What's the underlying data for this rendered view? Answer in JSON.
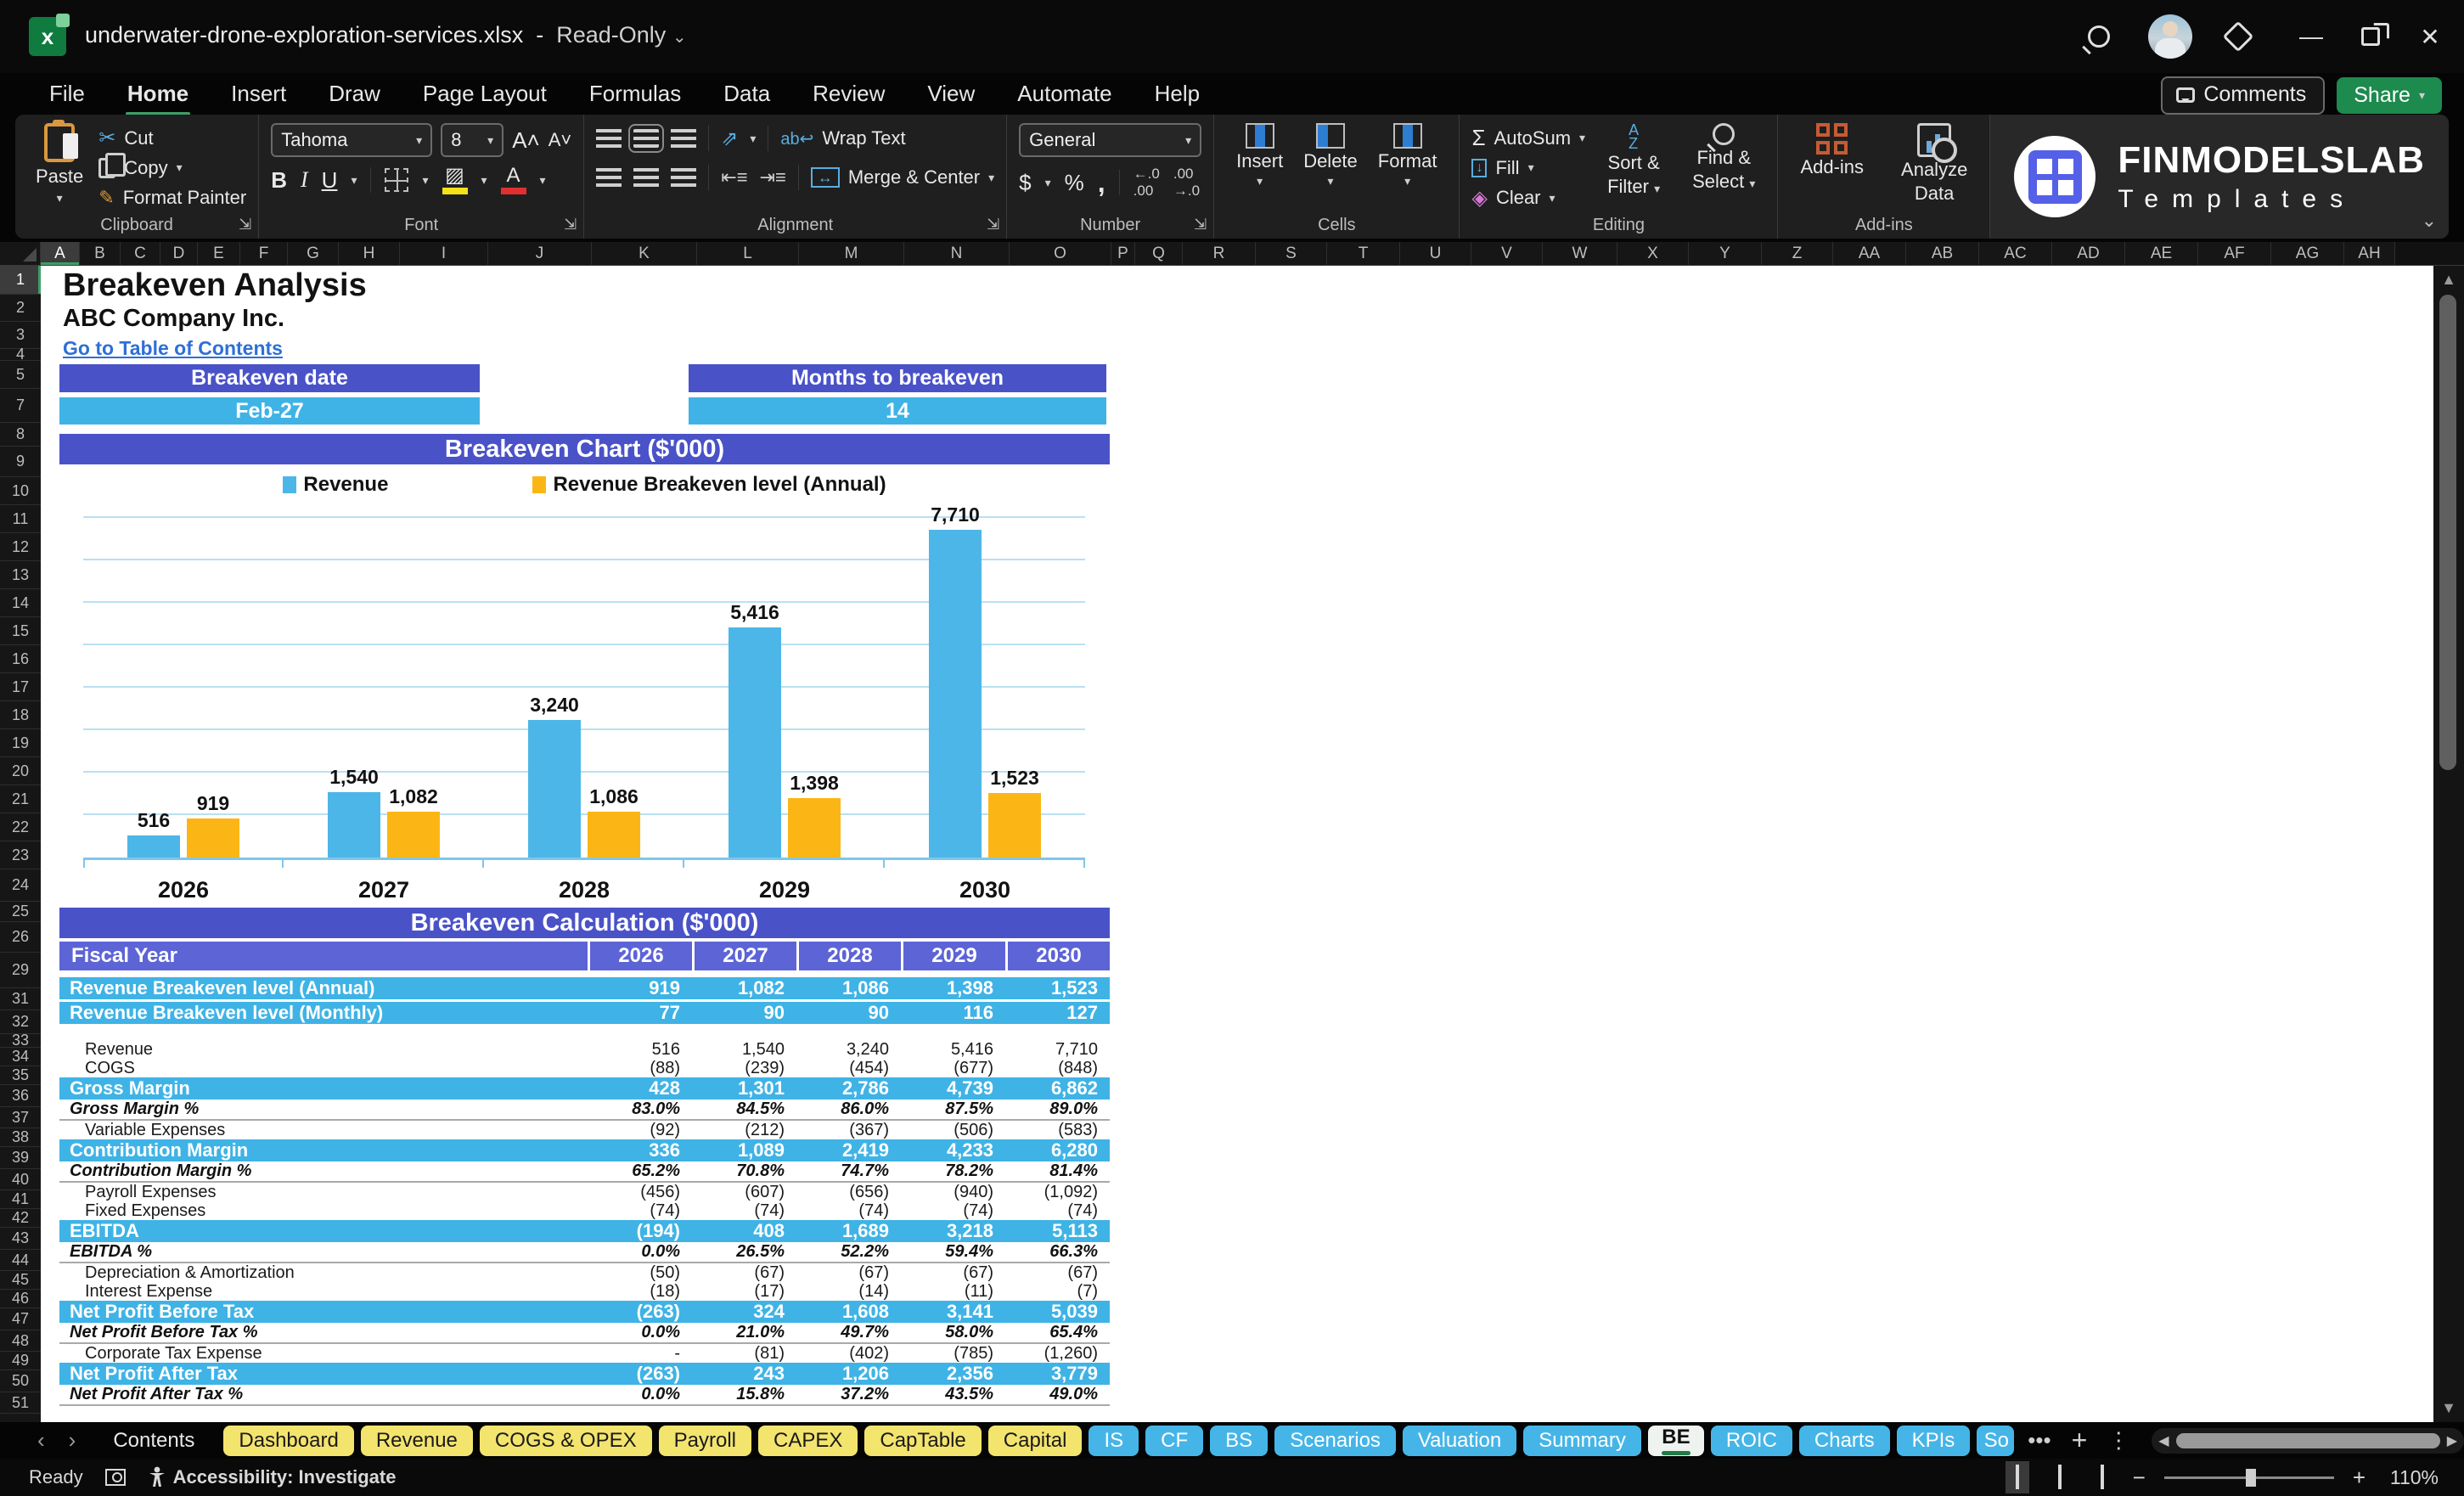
{
  "window": {
    "title": "underwater-drone-exploration-services.xlsx",
    "separator": "-",
    "mode": "Read-Only"
  },
  "menu": {
    "items": [
      "File",
      "Home",
      "Insert",
      "Draw",
      "Page Layout",
      "Formulas",
      "Data",
      "Review",
      "View",
      "Automate",
      "Help"
    ],
    "active": "Home"
  },
  "topright": {
    "comments": "Comments",
    "share": "Share"
  },
  "ribbon": {
    "clipboard": {
      "paste": "Paste",
      "cut": "Cut",
      "copy": "Copy",
      "format_painter": "Format Painter",
      "group": "Clipboard"
    },
    "font": {
      "family": "Tahoma",
      "size": "8",
      "bold": "B",
      "italic": "I",
      "underline": "U",
      "color_letter": "A",
      "group": "Font"
    },
    "alignment": {
      "wrap_text": "Wrap Text",
      "merge_center": "Merge & Center",
      "group": "Alignment"
    },
    "number": {
      "format": "General",
      "currency": "$",
      "percent": "%",
      "comma": ",",
      "group": "Number"
    },
    "cells": {
      "insert": "Insert",
      "delete": "Delete",
      "format": "Format",
      "group": "Cells"
    },
    "editing": {
      "autosum": "AutoSum",
      "fill": "Fill",
      "clear": "Clear",
      "sort_filter1": "Sort &",
      "sort_filter2": "Filter",
      "find_select1": "Find &",
      "find_select2": "Select",
      "sigma": "Σ",
      "group": "Editing"
    },
    "addins": {
      "addins": "Add-ins",
      "analyze1": "Analyze",
      "analyze2": "Data",
      "group": "Add-ins"
    },
    "logo": {
      "brand": "FINMODELSLAB",
      "sub": "Templates"
    }
  },
  "grid": {
    "columns": [
      {
        "label": "A",
        "w": 46
      },
      {
        "label": "B",
        "w": 48
      },
      {
        "label": "C",
        "w": 47
      },
      {
        "label": "D",
        "w": 44
      },
      {
        "label": "E",
        "w": 50
      },
      {
        "label": "F",
        "w": 56
      },
      {
        "label": "G",
        "w": 60
      },
      {
        "label": "H",
        "w": 72
      },
      {
        "label": "I",
        "w": 104
      },
      {
        "label": "J",
        "w": 122
      },
      {
        "label": "K",
        "w": 124
      },
      {
        "label": "L",
        "w": 120
      },
      {
        "label": "M",
        "w": 124
      },
      {
        "label": "N",
        "w": 124
      },
      {
        "label": "O",
        "w": 120
      },
      {
        "label": "P",
        "w": 28
      },
      {
        "label": "Q",
        "w": 56
      },
      {
        "label": "R",
        "w": 86
      },
      {
        "label": "S",
        "w": 84
      },
      {
        "label": "T",
        "w": 86
      },
      {
        "label": "U",
        "w": 84
      },
      {
        "label": "V",
        "w": 84
      },
      {
        "label": "W",
        "w": 88
      },
      {
        "label": "X",
        "w": 84
      },
      {
        "label": "Y",
        "w": 86
      },
      {
        "label": "Z",
        "w": 84
      },
      {
        "label": "AA",
        "w": 86
      },
      {
        "label": "AB",
        "w": 86
      },
      {
        "label": "AC",
        "w": 86
      },
      {
        "label": "AD",
        "w": 86
      },
      {
        "label": "AE",
        "w": 86
      },
      {
        "label": "AF",
        "w": 86
      },
      {
        "label": "AG",
        "w": 86
      },
      {
        "label": "AH",
        "w": 60
      }
    ],
    "rows": [
      {
        "n": "1",
        "h": 34
      },
      {
        "n": "2",
        "h": 32
      },
      {
        "n": "3",
        "h": 32
      },
      {
        "n": "4",
        "h": 14
      },
      {
        "n": "5",
        "h": 33
      },
      {
        "n": "7",
        "h": 40
      },
      {
        "n": "8",
        "h": 28
      },
      {
        "n": "9",
        "h": 36
      },
      {
        "n": "10",
        "h": 33
      },
      {
        "n": "11",
        "h": 33
      },
      {
        "n": "12",
        "h": 33
      },
      {
        "n": "13",
        "h": 33
      },
      {
        "n": "14",
        "h": 33
      },
      {
        "n": "15",
        "h": 33
      },
      {
        "n": "16",
        "h": 33
      },
      {
        "n": "17",
        "h": 33
      },
      {
        "n": "18",
        "h": 33
      },
      {
        "n": "19",
        "h": 33
      },
      {
        "n": "20",
        "h": 33
      },
      {
        "n": "21",
        "h": 33
      },
      {
        "n": "22",
        "h": 33
      },
      {
        "n": "23",
        "h": 33
      },
      {
        "n": "24",
        "h": 38
      },
      {
        "n": "25",
        "h": 24
      },
      {
        "n": "26",
        "h": 36
      },
      {
        "n": "29",
        "h": 42
      },
      {
        "n": "31",
        "h": 26
      },
      {
        "n": "32",
        "h": 28
      },
      {
        "n": "33",
        "h": 16
      },
      {
        "n": "34",
        "h": 22
      },
      {
        "n": "35",
        "h": 22
      },
      {
        "n": "36",
        "h": 26
      },
      {
        "n": "37",
        "h": 25
      },
      {
        "n": "38",
        "h": 22
      },
      {
        "n": "39",
        "h": 26
      },
      {
        "n": "40",
        "h": 25
      },
      {
        "n": "41",
        "h": 22
      },
      {
        "n": "42",
        "h": 22
      },
      {
        "n": "43",
        "h": 26
      },
      {
        "n": "44",
        "h": 25
      },
      {
        "n": "45",
        "h": 22
      },
      {
        "n": "46",
        "h": 22
      },
      {
        "n": "47",
        "h": 26
      },
      {
        "n": "48",
        "h": 25
      },
      {
        "n": "49",
        "h": 22
      },
      {
        "n": "50",
        "h": 26
      },
      {
        "n": "51",
        "h": 25
      }
    ]
  },
  "sheet": {
    "title": "Breakeven Analysis",
    "company": "ABC Company Inc.",
    "link": "Go to Table of Contents",
    "kpis": [
      {
        "header": "Breakeven date",
        "value": "Feb-27"
      },
      {
        "header": "Months to breakeven",
        "value": "14"
      }
    ],
    "chart_title": "Breakeven Chart ($'000)",
    "table_title": "Breakeven Calculation ($'000)"
  },
  "chart_data": {
    "type": "bar",
    "title": "Breakeven Chart ($'000)",
    "categories": [
      "2026",
      "2027",
      "2028",
      "2029",
      "2030"
    ],
    "series": [
      {
        "name": "Revenue",
        "color": "#4db6e8",
        "values": [
          516,
          1540,
          3240,
          5416,
          7710
        ],
        "labels": [
          "516",
          "1,540",
          "3,240",
          "5,416",
          "7,710"
        ]
      },
      {
        "name": "Revenue Breakeven level (Annual)",
        "color": "#fbb616",
        "values": [
          919,
          1082,
          1086,
          1398,
          1523
        ],
        "labels": [
          "919",
          "1,082",
          "1,086",
          "1,398",
          "1,523"
        ]
      }
    ],
    "ylim": [
      0,
      8000
    ],
    "gridline_step": 1000,
    "grid": true,
    "legend_position": "top",
    "xlabel": "",
    "ylabel": ""
  },
  "table": {
    "header": {
      "label": "Fiscal Year",
      "years": [
        "2026",
        "2027",
        "2028",
        "2029",
        "2030"
      ]
    },
    "rows": [
      {
        "label": "Revenue Breakeven level (Annual)",
        "values": [
          "919",
          "1,082",
          "1,086",
          "1,398",
          "1,523"
        ],
        "style": "highlight"
      },
      {
        "label": "Revenue Breakeven level (Monthly)",
        "values": [
          "77",
          "90",
          "90",
          "116",
          "127"
        ],
        "style": "highlight"
      },
      {
        "style": "gap"
      },
      {
        "label": "Revenue",
        "values": [
          "516",
          "1,540",
          "3,240",
          "5,416",
          "7,710"
        ],
        "style": "plain"
      },
      {
        "label": "COGS",
        "values": [
          "(88)",
          "(239)",
          "(454)",
          "(677)",
          "(848)"
        ],
        "style": "plain"
      },
      {
        "label": "Gross Margin",
        "values": [
          "428",
          "1,301",
          "2,786",
          "4,739",
          "6,862"
        ],
        "style": "subtotal"
      },
      {
        "label": "Gross Margin %",
        "values": [
          "83.0%",
          "84.5%",
          "86.0%",
          "87.5%",
          "89.0%"
        ],
        "style": "percent"
      },
      {
        "label": "Variable Expenses",
        "values": [
          "(92)",
          "(212)",
          "(367)",
          "(506)",
          "(583)"
        ],
        "style": "plain"
      },
      {
        "label": "Contribution Margin",
        "values": [
          "336",
          "1,089",
          "2,419",
          "4,233",
          "6,280"
        ],
        "style": "subtotal"
      },
      {
        "label": "Contribution Margin %",
        "values": [
          "65.2%",
          "70.8%",
          "74.7%",
          "78.2%",
          "81.4%"
        ],
        "style": "percent"
      },
      {
        "label": "Payroll Expenses",
        "values": [
          "(456)",
          "(607)",
          "(656)",
          "(940)",
          "(1,092)"
        ],
        "style": "plain"
      },
      {
        "label": "Fixed Expenses",
        "values": [
          "(74)",
          "(74)",
          "(74)",
          "(74)",
          "(74)"
        ],
        "style": "plain"
      },
      {
        "label": "EBITDA",
        "values": [
          "(194)",
          "408",
          "1,689",
          "3,218",
          "5,113"
        ],
        "style": "subtotal"
      },
      {
        "label": "EBITDA %",
        "values": [
          "0.0%",
          "26.5%",
          "52.2%",
          "59.4%",
          "66.3%"
        ],
        "style": "percent"
      },
      {
        "label": "Depreciation & Amortization",
        "values": [
          "(50)",
          "(67)",
          "(67)",
          "(67)",
          "(67)"
        ],
        "style": "plain"
      },
      {
        "label": "Interest Expense",
        "values": [
          "(18)",
          "(17)",
          "(14)",
          "(11)",
          "(7)"
        ],
        "style": "plain"
      },
      {
        "label": "Net Profit Before Tax",
        "values": [
          "(263)",
          "324",
          "1,608",
          "3,141",
          "5,039"
        ],
        "style": "subtotal"
      },
      {
        "label": "Net Profit Before Tax %",
        "values": [
          "0.0%",
          "21.0%",
          "49.7%",
          "58.0%",
          "65.4%"
        ],
        "style": "percent"
      },
      {
        "label": "Corporate Tax Expense",
        "values": [
          "-",
          "(81)",
          "(402)",
          "(785)",
          "(1,260)"
        ],
        "style": "plain"
      },
      {
        "label": "Net Profit After Tax",
        "values": [
          "(263)",
          "243",
          "1,206",
          "2,356",
          "3,779"
        ],
        "style": "subtotal"
      },
      {
        "label": "Net Profit After Tax %",
        "values": [
          "0.0%",
          "15.8%",
          "37.2%",
          "43.5%",
          "49.0%"
        ],
        "style": "percent"
      }
    ]
  },
  "tabs": {
    "items": [
      {
        "label": "Contents",
        "type": "plain"
      },
      {
        "label": "Dashboard",
        "type": "yellow"
      },
      {
        "label": "Revenue",
        "type": "yellow"
      },
      {
        "label": "COGS & OPEX",
        "type": "yellow"
      },
      {
        "label": "Payroll",
        "type": "yellow"
      },
      {
        "label": "CAPEX",
        "type": "yellow"
      },
      {
        "label": "CapTable",
        "type": "yellow"
      },
      {
        "label": "Capital",
        "type": "yellow"
      },
      {
        "label": "IS",
        "type": "blue"
      },
      {
        "label": "CF",
        "type": "blue"
      },
      {
        "label": "BS",
        "type": "blue"
      },
      {
        "label": "Scenarios",
        "type": "blue"
      },
      {
        "label": "Valuation",
        "type": "blue"
      },
      {
        "label": "Summary",
        "type": "blue"
      },
      {
        "label": "BE",
        "type": "active"
      },
      {
        "label": "ROIC",
        "type": "blue"
      },
      {
        "label": "Charts",
        "type": "blue"
      },
      {
        "label": "KPIs",
        "type": "blue"
      },
      {
        "label": "So",
        "type": "blue clipped"
      }
    ],
    "overflow": "•••",
    "add": "+",
    "menu": "⋮",
    "back": "‹",
    "fwd": "›"
  },
  "statusbar": {
    "ready": "Ready",
    "accessibility": "Accessibility: Investigate",
    "zoom": "110%"
  },
  "colors": {
    "accent_purple": "#4a52c8",
    "accent_blue": "#3fb3e6",
    "bar_blue": "#4db6e8",
    "bar_yellow": "#fbb616",
    "tab_yellow": "#f3e46e",
    "active_green": "#1f7a46",
    "link_blue": "#2e6fd6"
  }
}
